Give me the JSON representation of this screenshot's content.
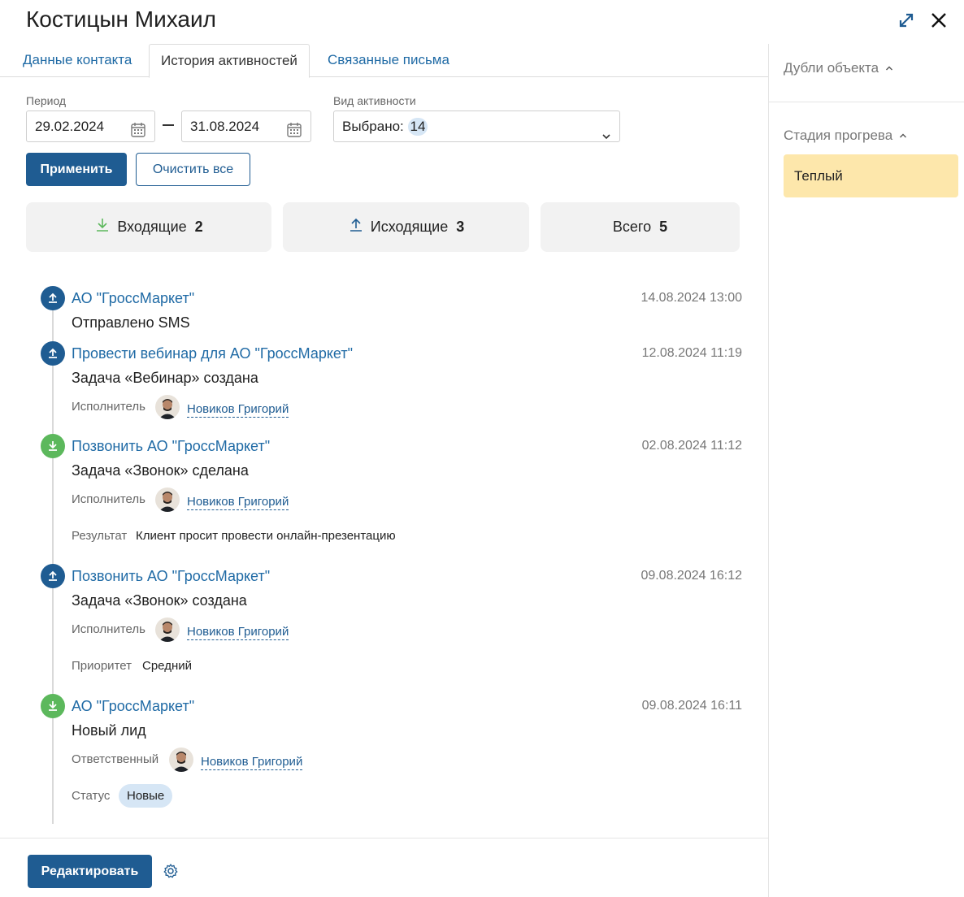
{
  "header": {
    "title": "Костицын Михаил"
  },
  "tabs": [
    {
      "label": "Данные контакта"
    },
    {
      "label": "История активностей"
    },
    {
      "label": "Связанные письма"
    }
  ],
  "filters": {
    "period_label": "Период",
    "date_from": "29.02.2024",
    "date_to": "31.08.2024",
    "activity_label": "Вид активности",
    "activity_prefix": "Выбрано:",
    "activity_count": "14",
    "apply_label": "Применить",
    "clear_label": "Очистить все"
  },
  "stats": {
    "incoming_label": "Входящие",
    "incoming_count": "2",
    "outgoing_label": "Исходящие",
    "outgoing_count": "3",
    "total_label": "Всего",
    "total_count": "5"
  },
  "events": [
    {
      "direction": "outgoing",
      "title": "АО \"ГроссМаркет\"",
      "date": "14.08.2024 13:00",
      "subtitle": "Отправлено SMS"
    },
    {
      "direction": "outgoing",
      "title": "Провести вебинар для АО \"ГроссМаркет\"",
      "date": "12.08.2024 11:19",
      "subtitle": "Задача «Вебинар» создана",
      "assignee_label": "Исполнитель",
      "assignee": "Новиков Григорий"
    },
    {
      "direction": "incoming",
      "title": "Позвонить АО \"ГроссМаркет\"",
      "date": "02.08.2024 11:12",
      "subtitle": "Задача «Звонок» сделана",
      "assignee_label": "Исполнитель",
      "assignee": "Новиков Григорий",
      "result_label": "Результат",
      "result": "Клиент просит провести онлайн-презентацию"
    },
    {
      "direction": "outgoing",
      "title": "Позвонить АО \"ГроссМаркет\"",
      "date": "09.08.2024 16:12",
      "subtitle": "Задача «Звонок» создана",
      "assignee_label": "Исполнитель",
      "assignee": "Новиков Григорий",
      "priority_label": "Приоритет",
      "priority": "Средний"
    },
    {
      "direction": "incoming",
      "title": "АО \"ГроссМаркет\"",
      "date": "09.08.2024 16:11",
      "subtitle": "Новый лид",
      "owner_label": "Ответственный",
      "owner": "Новиков Григорий",
      "status_label": "Статус",
      "status": "Новые"
    }
  ],
  "sidebar": {
    "duplicates_label": "Дубли объекта",
    "stage_label": "Стадия прогрева",
    "stage_value": "Теплый"
  },
  "footer": {
    "edit_label": "Редактировать"
  },
  "colors": {
    "primary": "#1f5c92",
    "link": "#1f6aa5",
    "incoming": "#5cb85c",
    "stage_bg": "#fde7ab",
    "pill_bg": "#d6e6f5"
  },
  "icons": [
    "expand-icon",
    "close-icon",
    "calendar-icon",
    "chevron-down-icon",
    "download-icon",
    "upload-icon",
    "chevron-up-icon",
    "gear-icon"
  ]
}
